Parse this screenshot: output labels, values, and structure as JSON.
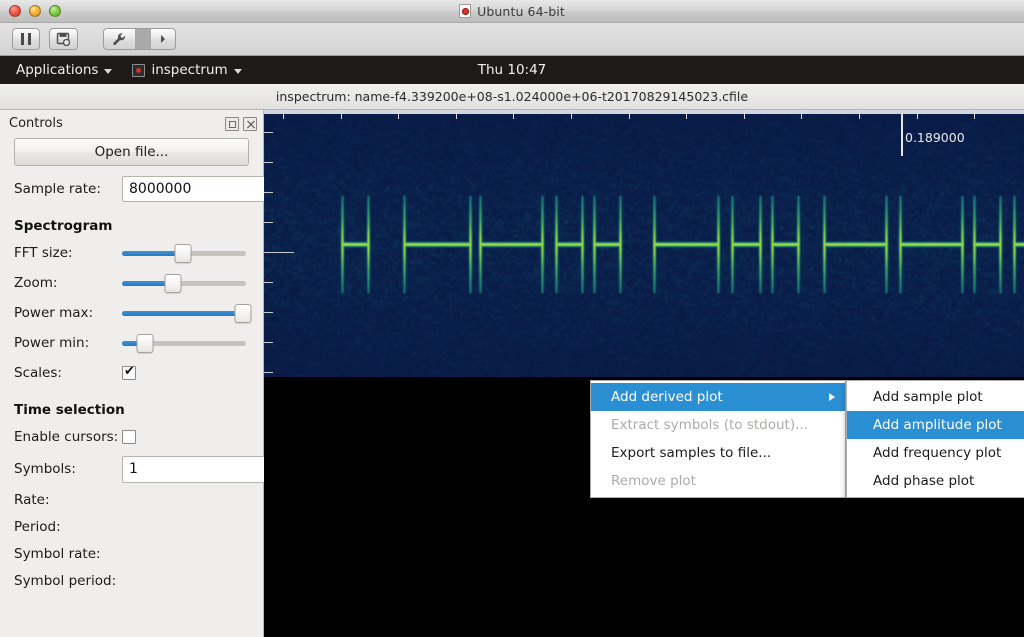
{
  "vm": {
    "title": "Ubuntu 64-bit",
    "title_icon": "vm-file-icon",
    "toolbar": {
      "pause_label": "pause-icon",
      "snapshot_label": "snapshot-icon",
      "settings_label": "wrench-icon",
      "more_label": "chevron-right-icon"
    },
    "traffic_lights": [
      "close-red",
      "minimize-yellow",
      "zoom-green"
    ]
  },
  "ubuntu_panel": {
    "applications_label": "Applications",
    "app_name": "inspectrum",
    "clock": "Thu 10:47"
  },
  "app": {
    "window_title": "inspectrum: name-f4.339200e+08-s1.024000e+06-t20170829145023.cfile"
  },
  "sidebar": {
    "dock_title": "Controls",
    "open_file_label": "Open file...",
    "sample_rate": {
      "label": "Sample rate:",
      "value": "8000000"
    },
    "spectrogram": {
      "section_title": "Spectrogram",
      "sliders": [
        {
          "label": "FFT size:",
          "value": 48
        },
        {
          "label": "Zoom:",
          "value": 40
        },
        {
          "label": "Power max:",
          "value": 95
        },
        {
          "label": "Power min:",
          "value": 18
        }
      ],
      "scales": {
        "label": "Scales:",
        "checked": true
      }
    },
    "time_selection": {
      "section_title": "Time selection",
      "enable_cursors": {
        "label": "Enable cursors:",
        "checked": false
      },
      "symbols": {
        "label": "Symbols:",
        "value": "1"
      },
      "readouts": [
        {
          "label": "Rate:",
          "value": ""
        },
        {
          "label": "Period:",
          "value": ""
        },
        {
          "label": "Symbol rate:",
          "value": ""
        },
        {
          "label": "Symbol period:",
          "value": ""
        }
      ]
    }
  },
  "plot": {
    "time_cursor_label": "0.189000",
    "background": "#000000",
    "spectrogram_low_color": "#0a1940",
    "spectrogram_mid_color": "#18707f",
    "spectrogram_high_color": "#8fd446"
  },
  "context_menu": {
    "items": [
      {
        "label": "Add derived plot",
        "selected": true,
        "disabled": false,
        "submenu": true
      },
      {
        "label": "Extract symbols (to stdout)...",
        "selected": false,
        "disabled": true,
        "submenu": false
      },
      {
        "label": "Export samples to file...",
        "selected": false,
        "disabled": false,
        "submenu": false
      },
      {
        "label": "Remove plot",
        "selected": false,
        "disabled": true,
        "submenu": false
      }
    ]
  },
  "submenu": {
    "items": [
      {
        "label": "Add sample plot",
        "selected": false
      },
      {
        "label": "Add amplitude plot",
        "selected": true
      },
      {
        "label": "Add frequency plot",
        "selected": false
      },
      {
        "label": "Add phase plot",
        "selected": false
      }
    ]
  },
  "colors": {
    "highlight": "#2b8fd4",
    "panel_bg": "#efeeec",
    "slider_fill": "#2a7fc9",
    "ubuntu_panel_bg": "#1d1a19"
  }
}
